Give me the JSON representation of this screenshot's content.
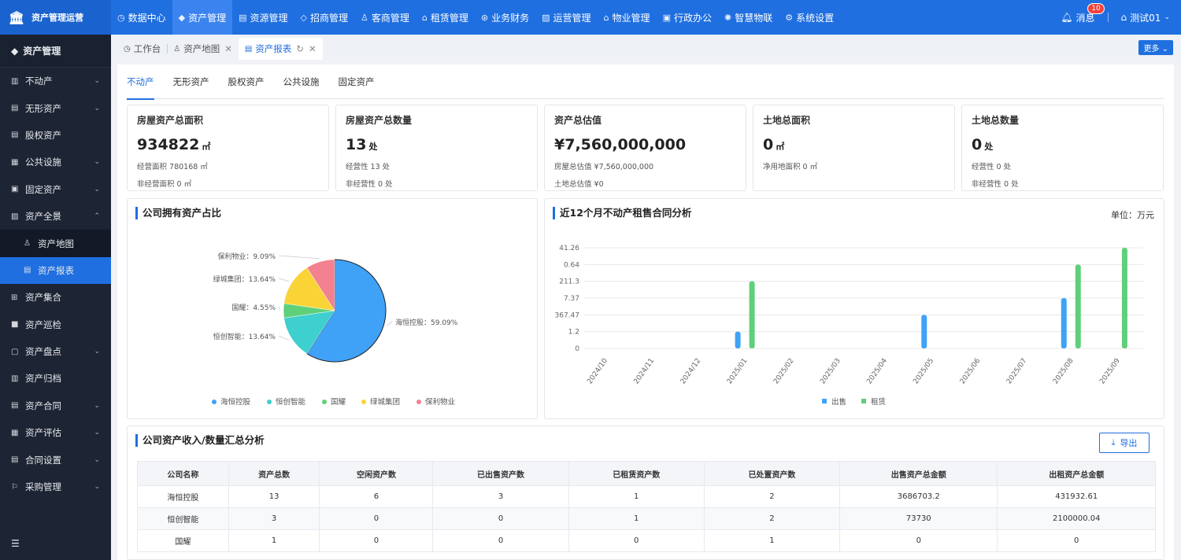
{
  "app": {
    "logo_icon": "bank-icon",
    "title": "资产管理运营"
  },
  "topnav": [
    {
      "label": "数据中心",
      "icon": "dashboard-icon",
      "glyph": "◷",
      "active": false
    },
    {
      "label": "资产管理",
      "icon": "cube-icon",
      "glyph": "◆",
      "active": true
    },
    {
      "label": "资源管理",
      "icon": "building-icon",
      "glyph": "▤",
      "active": false
    },
    {
      "label": "招商管理",
      "icon": "tag-icon",
      "glyph": "◇",
      "active": false
    },
    {
      "label": "客商管理",
      "icon": "users-icon",
      "glyph": "♙",
      "active": false
    },
    {
      "label": "租赁管理",
      "icon": "house-icon",
      "glyph": "⌂",
      "active": false
    },
    {
      "label": "业务财务",
      "icon": "money-icon",
      "glyph": "⊛",
      "active": false
    },
    {
      "label": "运营管理",
      "icon": "chart-icon",
      "glyph": "▨",
      "active": false
    },
    {
      "label": "物业管理",
      "icon": "home-icon",
      "glyph": "⌂",
      "active": false
    },
    {
      "label": "行政办公",
      "icon": "office-icon",
      "glyph": "▣",
      "active": false
    },
    {
      "label": "智慧物联",
      "icon": "iot-icon",
      "glyph": "✺",
      "active": false
    },
    {
      "label": "系统设置",
      "icon": "gear-icon",
      "glyph": "⚙",
      "active": false
    }
  ],
  "topright": {
    "messages_label": "消息",
    "messages_count": "10",
    "user_label": "测试01",
    "bell_icon": "bell-icon",
    "user_icon": "org-icon"
  },
  "sidebar": {
    "title": "资产管理",
    "items": [
      {
        "label": "不动产",
        "icon": "building-icon",
        "glyph": "▥",
        "arrow": "⌄",
        "sub": false,
        "active": false
      },
      {
        "label": "无形资产",
        "icon": "doc-icon",
        "glyph": "▤",
        "arrow": "⌄",
        "sub": false,
        "active": false
      },
      {
        "label": "股权资产",
        "icon": "stack-icon",
        "glyph": "▤",
        "arrow": "",
        "sub": false,
        "active": false
      },
      {
        "label": "公共设施",
        "icon": "facility-icon",
        "glyph": "▦",
        "arrow": "⌄",
        "sub": false,
        "active": false
      },
      {
        "label": "固定资产",
        "icon": "monitor-icon",
        "glyph": "▣",
        "arrow": "⌄",
        "sub": false,
        "active": false
      },
      {
        "label": "资产全景",
        "icon": "panorama-icon",
        "glyph": "▨",
        "arrow": "⌃",
        "sub": false,
        "active": false
      },
      {
        "label": "资产地图",
        "icon": "map-pin-icon",
        "glyph": "♙",
        "arrow": "",
        "sub": true,
        "active": false
      },
      {
        "label": "资产报表",
        "icon": "report-icon",
        "glyph": "▤",
        "arrow": "",
        "sub": true,
        "active": true
      },
      {
        "label": "资产集合",
        "icon": "grid-icon",
        "glyph": "⊞",
        "arrow": "",
        "sub": false,
        "active": false
      },
      {
        "label": "资产巡检",
        "icon": "inspect-icon",
        "glyph": "■",
        "arrow": "",
        "sub": false,
        "active": false
      },
      {
        "label": "资产盘点",
        "icon": "inventory-icon",
        "glyph": "▢",
        "arrow": "⌄",
        "sub": false,
        "active": false
      },
      {
        "label": "资产归档",
        "icon": "archive-icon",
        "glyph": "▥",
        "arrow": "",
        "sub": false,
        "active": false
      },
      {
        "label": "资产合同",
        "icon": "contract-icon",
        "glyph": "▤",
        "arrow": "⌄",
        "sub": false,
        "active": false
      },
      {
        "label": "资产评估",
        "icon": "evaluate-icon",
        "glyph": "▦",
        "arrow": "⌄",
        "sub": false,
        "active": false
      },
      {
        "label": "合同设置",
        "icon": "contract-setting-icon",
        "glyph": "▤",
        "arrow": "⌄",
        "sub": false,
        "active": false
      },
      {
        "label": "采购管理",
        "icon": "purchase-icon",
        "glyph": "⚐",
        "arrow": "⌄",
        "sub": false,
        "active": false
      }
    ]
  },
  "tabs": [
    {
      "label": "工作台",
      "icon": "dashboard-icon",
      "glyph": "◷",
      "close": false,
      "refresh": false,
      "active": false
    },
    {
      "label": "资产地图",
      "icon": "map-pin-icon",
      "glyph": "♙",
      "close": true,
      "refresh": false,
      "active": false
    },
    {
      "label": "资产报表",
      "icon": "report-icon",
      "glyph": "▤",
      "close": true,
      "refresh": true,
      "active": true
    }
  ],
  "more_label": "更多 ⌄",
  "subtabs": [
    {
      "label": "不动产",
      "active": true
    },
    {
      "label": "无形资产",
      "active": false
    },
    {
      "label": "股权资产",
      "active": false
    },
    {
      "label": "公共设施",
      "active": false
    },
    {
      "label": "固定资产",
      "active": false
    }
  ],
  "cards": [
    {
      "title": "房屋资产总面积",
      "value": "934822",
      "unit": "㎡",
      "line1": "经营面积 780168 ㎡",
      "line2": "非经营面积 0 ㎡"
    },
    {
      "title": "房屋资产总数量",
      "value": "13",
      "unit": "处",
      "line1": "经营性 13 处",
      "line2": "非经营性 0 处"
    },
    {
      "title": "资产总估值",
      "value": "¥7,560,000,000",
      "unit": "",
      "line1": "房屋总估值 ¥7,560,000,000",
      "line2": "土地总估值 ¥0"
    },
    {
      "title": "土地总面积",
      "value": "0",
      "unit": "㎡",
      "line1": "净用地面积 0 ㎡",
      "line2": ""
    },
    {
      "title": "土地总数量",
      "value": "0",
      "unit": "处",
      "line1": "经营性 0 处",
      "line2": "非经营性 0 处"
    }
  ],
  "pie_title": "公司拥有资产占比",
  "bar_title": "近12个月不动产租售合同分析",
  "bar_unit": "单位：万元",
  "chart_data": [
    {
      "type": "pie",
      "title": "公司拥有资产占比",
      "slices": [
        {
          "name": "海恒控股",
          "label": "海恒控股：59.09%",
          "value": 59.09,
          "color": "#3fa2f7"
        },
        {
          "name": "恒创智能",
          "label": "恒创智能：13.64%",
          "value": 13.64,
          "color": "#3ecfcf"
        },
        {
          "name": "国耀",
          "label": "国耀：4.55%",
          "value": 4.55,
          "color": "#5fd07a"
        },
        {
          "name": "绿城集团",
          "label": "绿城集团：13.64%",
          "value": 13.64,
          "color": "#fad337"
        },
        {
          "name": "保利物业",
          "label": "保利物业：9.09%",
          "value": 9.09,
          "color": "#f4818f"
        }
      ],
      "legend": "bottom"
    },
    {
      "type": "bar",
      "title": "近12个月不动产租售合同分析",
      "categories": [
        "2024/10",
        "2024/11",
        "2024/12",
        "2025/01",
        "2025/02",
        "2025/03",
        "2025/04",
        "2025/05",
        "2025/06",
        "2025/07",
        "2025/08",
        "2025/09"
      ],
      "y_ticks": [
        "0",
        "1.2",
        "367.47",
        "7.37",
        "211.3",
        "0.64",
        "41.26"
      ],
      "series": [
        {
          "name": "出售",
          "color": "#3fa2f7",
          "values": [
            0,
            0,
            0,
            1,
            0,
            0,
            0,
            2,
            0,
            0,
            3,
            0
          ]
        },
        {
          "name": "租赁",
          "color": "#5fd07a",
          "values": [
            0,
            0,
            0,
            4,
            0,
            0,
            0,
            0,
            0,
            0,
            5,
            6
          ]
        }
      ],
      "legend": "bottom",
      "grid": true
    }
  ],
  "table_title": "公司资产收入/数量汇总分析",
  "export_label": "导出",
  "table": {
    "headers": [
      "公司名称",
      "资产总数",
      "空闲资产数",
      "已出售资产数",
      "已租赁资产数",
      "已处置资产数",
      "出售资产总金额",
      "出租资产总金额"
    ],
    "rows": [
      [
        "海恒控股",
        "13",
        "6",
        "3",
        "1",
        "2",
        "3686703.2",
        "431932.61"
      ],
      [
        "恒创智能",
        "3",
        "0",
        "0",
        "1",
        "2",
        "73730",
        "2100000.04"
      ],
      [
        "国耀",
        "1",
        "0",
        "0",
        "0",
        "1",
        "0",
        "0"
      ]
    ]
  }
}
